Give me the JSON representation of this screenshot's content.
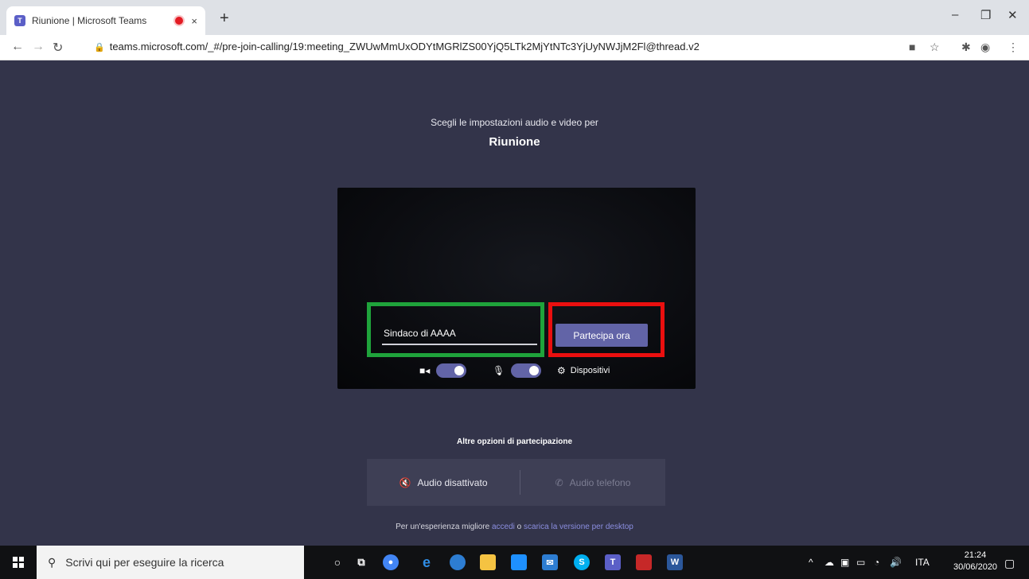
{
  "browser": {
    "tab_title": "Riunione | Microsoft Teams",
    "tab_close": "×",
    "new_tab": "+",
    "url": "teams.microsoft.com/_#/pre-join-calling/19:meeting_ZWUwMmUxODYtMGRlZS00YjQ5LTk2MjYtNTc3YjUyNWJjM2Fl@thread.v2",
    "minimize": "–",
    "restore": "❐",
    "close": "✕"
  },
  "prejoin": {
    "subtitle": "Scegli le impostazioni audio e video per",
    "title": "Riunione",
    "name_value": "Sindaco di AAAA",
    "join_label": "Partecipa ora",
    "video_on": true,
    "mic_on": true,
    "devices_label": "Dispositivi",
    "other_options_title": "Altre opzioni di partecipazione",
    "audio_off_label": "Audio disattivato",
    "phone_audio_label": "Audio telefono",
    "footer_prefix": "Per un'esperienza migliore",
    "footer_link1": "accedi",
    "footer_mid": "o",
    "footer_link2": "scarica la versione per desktop"
  },
  "taskbar": {
    "search_placeholder": "Scrivi qui per eseguire la ricerca",
    "language": "ITA",
    "time": "21:24",
    "date": "30/06/2020"
  },
  "colors": {
    "teams_bg": "#33344a",
    "teams_accent": "#6264a7",
    "highlight_green": "#1fa33b",
    "highlight_red": "#ea0f0f"
  }
}
